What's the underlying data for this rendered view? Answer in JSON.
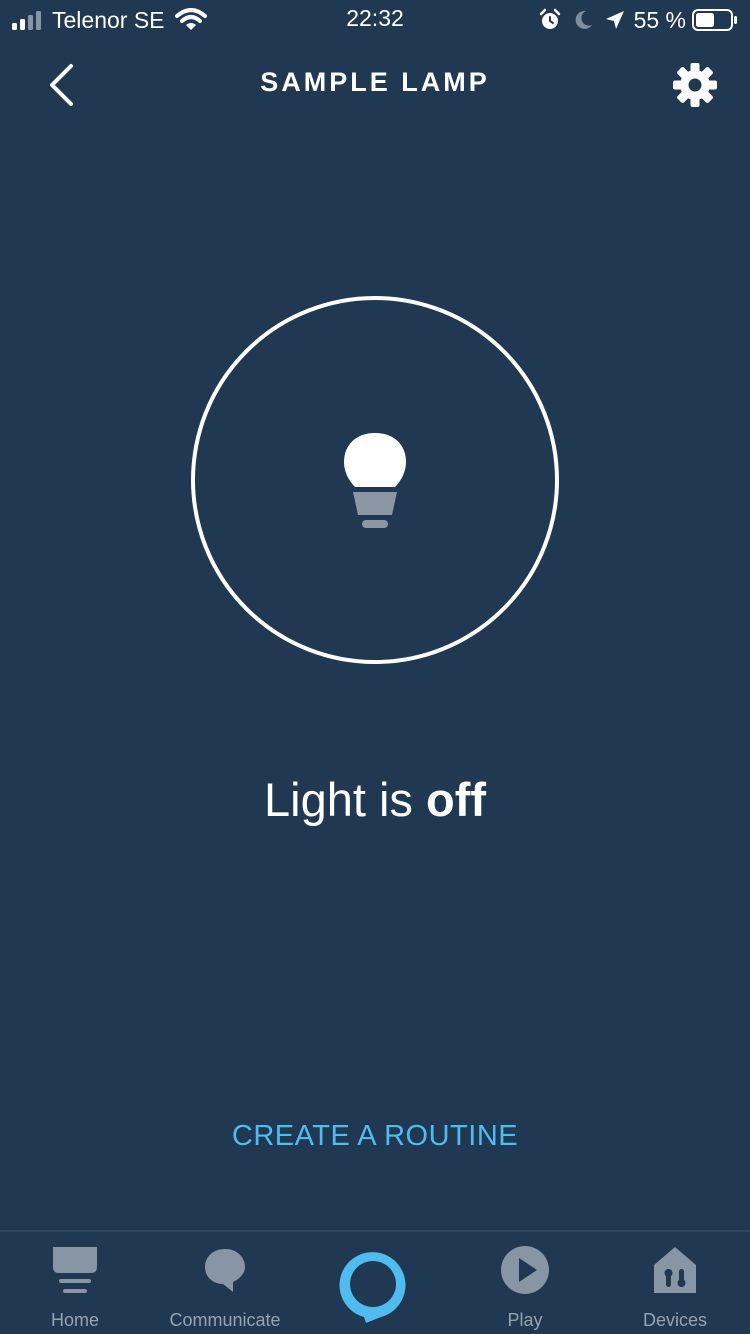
{
  "status_bar": {
    "carrier": "Telenor SE",
    "time": "22:32",
    "battery_percent": "55 %",
    "icons": [
      "signal-icon",
      "wifi-icon",
      "alarm-icon",
      "moon-icon",
      "location-icon",
      "battery-icon"
    ]
  },
  "header": {
    "title": "SAMPLE LAMP",
    "back_icon": "chevron-left-icon",
    "settings_icon": "gear-icon"
  },
  "device": {
    "icon": "lightbulb-icon",
    "status_prefix": "Light is ",
    "status_value": "off"
  },
  "actions": {
    "create_routine": "CREATE A ROUTINE"
  },
  "tab_bar": {
    "tabs": [
      {
        "label": "Home",
        "icon": "home-icon"
      },
      {
        "label": "Communicate",
        "icon": "speech-bubble-icon"
      },
      {
        "label": "",
        "icon": "alexa-icon"
      },
      {
        "label": "Play",
        "icon": "play-icon"
      },
      {
        "label": "Devices",
        "icon": "devices-icon"
      }
    ]
  },
  "colors": {
    "background": "#203851",
    "accent": "#4fbbee",
    "tab_inactive": "#95a4b3"
  }
}
